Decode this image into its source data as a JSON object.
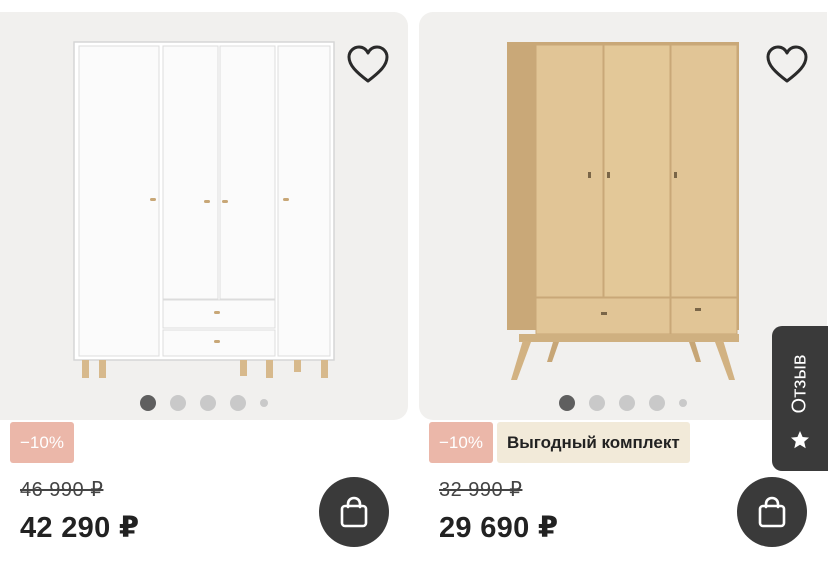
{
  "products": [
    {
      "discount_badge": "−10%",
      "old_price": "46 990 ₽",
      "price": "42 290 ₽",
      "image": "white-four-door-wardrobe",
      "dots": 5,
      "active_dot": 1
    },
    {
      "discount_badge": "−10%",
      "deal_badge": "Выгодный комплект",
      "old_price": "32 990 ₽",
      "price": "29 690 ₽",
      "image": "oak-three-door-wardrobe",
      "dots": 5,
      "active_dot": 1
    }
  ],
  "review_tab": {
    "label": "Отзыв",
    "icon": "star-icon"
  },
  "icons": {
    "favorite": "heart-icon",
    "cart": "shopping-bag-icon"
  },
  "colors": {
    "discount_badge_bg": "#ebb7a9",
    "deal_badge_bg": "#f2ead9",
    "dark_button": "#3a3a3a",
    "image_bg": "#f1f0ee"
  }
}
